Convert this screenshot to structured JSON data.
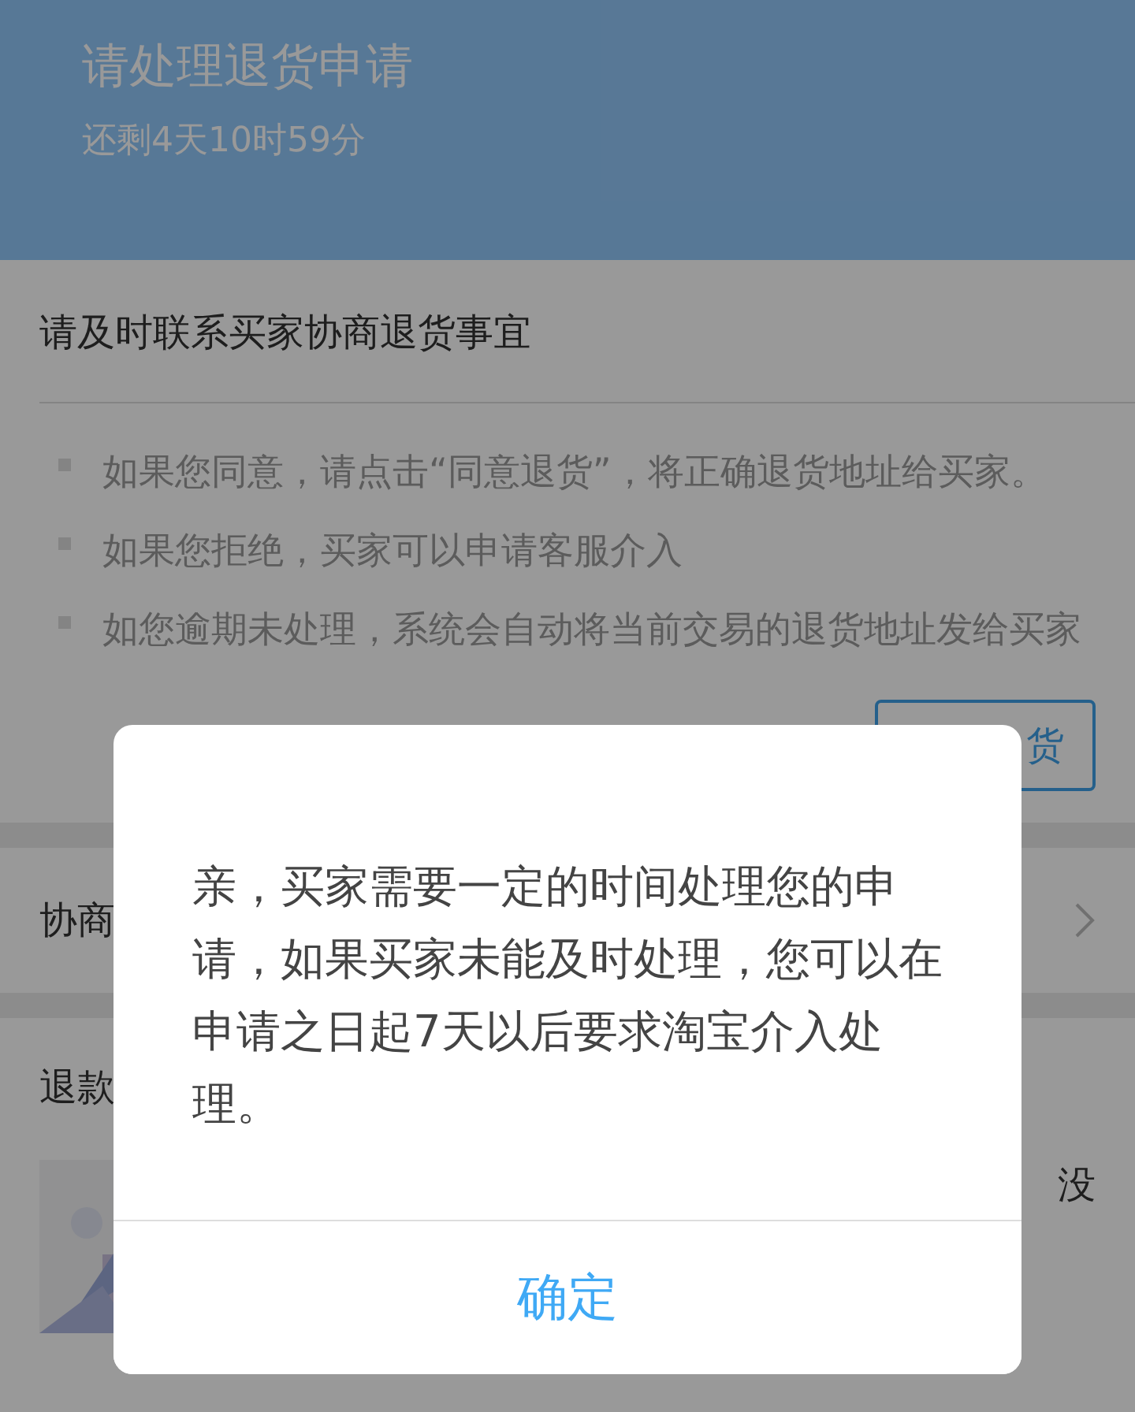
{
  "header": {
    "title": "请处理退货申请",
    "countdown": "还剩4天10时59分"
  },
  "notice": {
    "title": "请及时联系买家协商退货事宜",
    "bullets": [
      "如果您同意，请点击“同意退货”，将正确退货地址给买家。",
      "如果您拒绝，买家可以申请客服介入",
      "如您逾期未处理，系统会自动将当前交易的退货地址发给买家"
    ],
    "button": "货"
  },
  "negotiation_row": {
    "label": "协商"
  },
  "refund": {
    "label": "退款",
    "item_text": "没"
  },
  "dialog": {
    "message": "亲，买家需要一定的时间处理您的申请，如果买家未能及时处理，您可以在申请之日起7天以后要求淘宝介入处理。",
    "button": "确定"
  }
}
